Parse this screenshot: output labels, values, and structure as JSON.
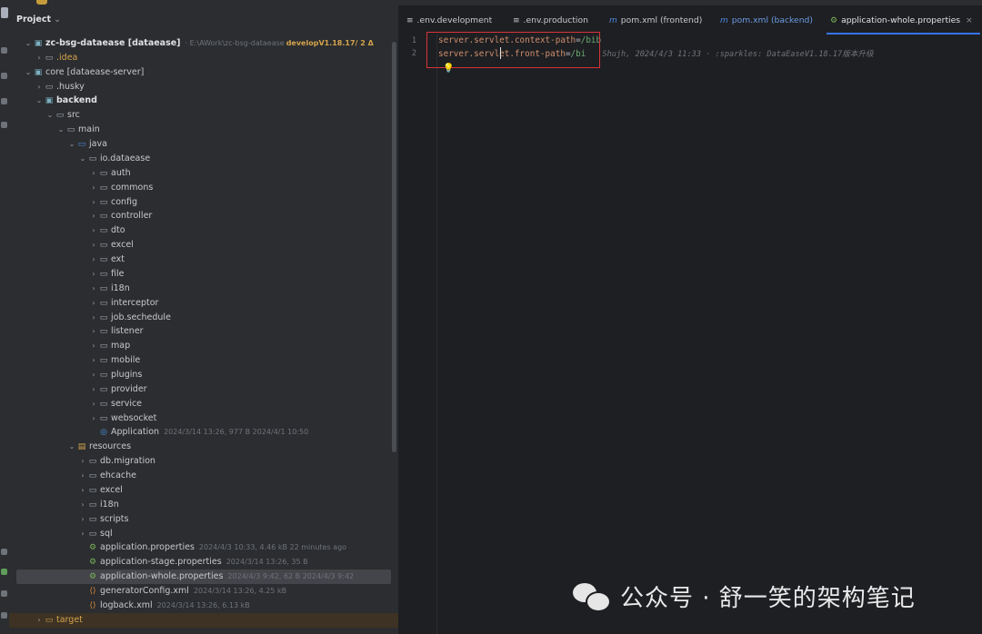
{
  "panel": {
    "title": "Project"
  },
  "tree": [
    {
      "label": "zc-bsg-dataease [dataease]",
      "path": "E:\\AWork\\zc-bsg-dataease",
      "branch": "developV1.18.17/ 2 Δ",
      "kind": "module"
    },
    {
      "label": ".idea",
      "kind": "folder"
    },
    {
      "label": "core [dataease-server]",
      "kind": "module"
    },
    {
      "label": ".husky",
      "kind": "folder"
    },
    {
      "label": "backend",
      "kind": "module"
    },
    {
      "label": "src",
      "kind": "folder"
    },
    {
      "label": "main",
      "kind": "folder"
    },
    {
      "label": "java",
      "kind": "folder"
    },
    {
      "label": "io.dataease",
      "kind": "package"
    },
    {
      "label": "auth",
      "kind": "package"
    },
    {
      "label": "commons",
      "kind": "package"
    },
    {
      "label": "config",
      "kind": "package"
    },
    {
      "label": "controller",
      "kind": "package"
    },
    {
      "label": "dto",
      "kind": "package"
    },
    {
      "label": "excel",
      "kind": "package"
    },
    {
      "label": "ext",
      "kind": "package"
    },
    {
      "label": "file",
      "kind": "package"
    },
    {
      "label": "i18n",
      "kind": "package"
    },
    {
      "label": "interceptor",
      "kind": "package"
    },
    {
      "label": "job.sechedule",
      "kind": "package"
    },
    {
      "label": "listener",
      "kind": "package"
    },
    {
      "label": "map",
      "kind": "package"
    },
    {
      "label": "mobile",
      "kind": "package"
    },
    {
      "label": "plugins",
      "kind": "package"
    },
    {
      "label": "provider",
      "kind": "package"
    },
    {
      "label": "service",
      "kind": "package"
    },
    {
      "label": "websocket",
      "kind": "package"
    },
    {
      "label": "Application",
      "meta": "2024/3/14 13:26, 977 B 2024/4/1 10:50",
      "kind": "java"
    },
    {
      "label": "resources",
      "kind": "resources"
    },
    {
      "label": "db.migration",
      "kind": "folder"
    },
    {
      "label": "ehcache",
      "kind": "folder"
    },
    {
      "label": "excel",
      "kind": "folder"
    },
    {
      "label": "i18n",
      "kind": "folder"
    },
    {
      "label": "scripts",
      "kind": "folder"
    },
    {
      "label": "sql",
      "kind": "folder"
    },
    {
      "label": "application.properties",
      "meta": "2024/4/3 10:33, 4.46 kB 22 minutes ago",
      "kind": "prop"
    },
    {
      "label": "application-stage.properties",
      "meta": "2024/3/14 13:26, 35 B",
      "kind": "prop"
    },
    {
      "label": "application-whole.properties",
      "meta": "2024/4/3 9:42, 62 B 2024/4/3 9:42",
      "kind": "prop",
      "selected": true
    },
    {
      "label": "generatorConfig.xml",
      "meta": "2024/3/14 13:26, 4.25 kB",
      "kind": "xml"
    },
    {
      "label": "logback.xml",
      "meta": "2024/3/14 13:26, 6.13 kB",
      "kind": "xml"
    },
    {
      "label": "target",
      "kind": "target"
    }
  ],
  "tabs": [
    {
      "label": ".env.development",
      "icon": "lines-icon"
    },
    {
      "label": ".env.production",
      "icon": "lines-icon"
    },
    {
      "label": "pom.xml (frontend)",
      "icon": "maven-icon"
    },
    {
      "label": "pom.xml (backend)",
      "icon": "maven-icon"
    },
    {
      "label": "application-whole.properties",
      "icon": "properties-icon",
      "active": true,
      "close": "×"
    }
  ],
  "editor": {
    "lines": [
      {
        "number": "1",
        "key": "server.servlet.context-path",
        "sep": "=",
        "value": "/bib"
      },
      {
        "number": "2",
        "key": "server.servlet.front-path",
        "sep": "=",
        "value": "/bi",
        "blame": "Shujh, 2024/4/3 11:33 · :sparkles: DataEaseV1.18.17版本升级"
      }
    ]
  },
  "watermark": {
    "text": "公众号 · 舒一笑的架构笔记"
  }
}
